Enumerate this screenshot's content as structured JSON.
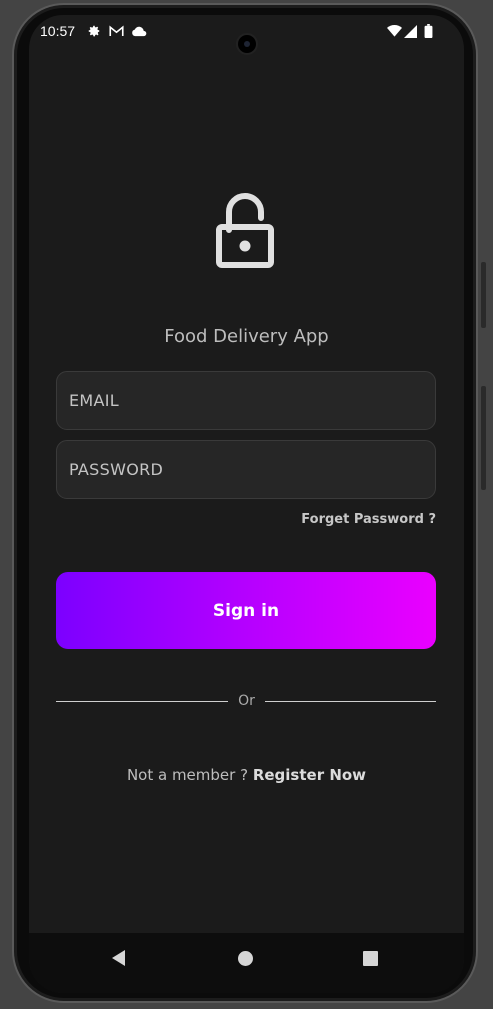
{
  "status_bar": {
    "time": "10:57",
    "icons": [
      "gear-icon",
      "gmail-icon",
      "cloud-icon",
      "wifi-icon",
      "signal-icon",
      "battery-icon"
    ]
  },
  "app": {
    "title": "Food Delivery App",
    "icon": "unlock-icon"
  },
  "form": {
    "email_placeholder": "EMAIL",
    "password_placeholder": "PASSWORD",
    "forgot_label": "Forget Password ?",
    "signin_label": "Sign in",
    "or_label": "Or",
    "member_text": "Not a member ?",
    "register_label": "Register Now"
  },
  "colors": {
    "background": "#1b1b1b",
    "field_bg": "#262626",
    "gradient_start": "#7c00ff",
    "gradient_end": "#ea00ff"
  },
  "nav": [
    "back-icon",
    "home-icon",
    "recents-icon"
  ]
}
